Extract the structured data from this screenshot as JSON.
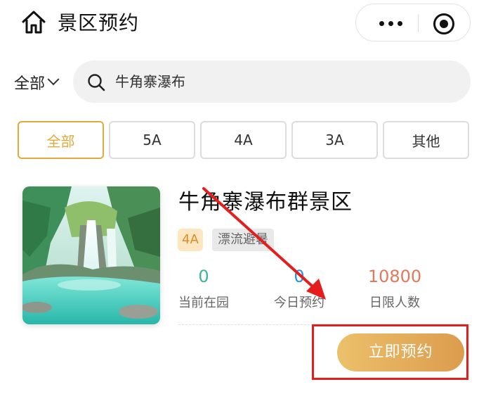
{
  "header": {
    "title": "景区预约",
    "home_icon": "home-icon",
    "more_icon": "more-dots-icon",
    "target_icon": "record-target-icon"
  },
  "search": {
    "filter_label": "全部",
    "value": "牛角寨瀑布",
    "icon": "search-icon"
  },
  "level_tabs": {
    "items": [
      "全部",
      "5A",
      "4A",
      "3A",
      "其他"
    ],
    "active_index": 0
  },
  "scenic": {
    "name": "牛角寨瀑布群景区",
    "level_tag": "4A",
    "theme_tag": "漂流避暑",
    "stats": [
      {
        "value": "0",
        "label": "当前在园",
        "color": "#3bb59a"
      },
      {
        "value": "0",
        "label": "今日预约",
        "color": "#2d8fe0"
      },
      {
        "value": "10800",
        "label": "日限人数",
        "color": "#e3795a"
      }
    ],
    "book_button": "立即预约"
  },
  "colors": {
    "accent": "#e3a93a",
    "annotation": "#e41d1d"
  }
}
